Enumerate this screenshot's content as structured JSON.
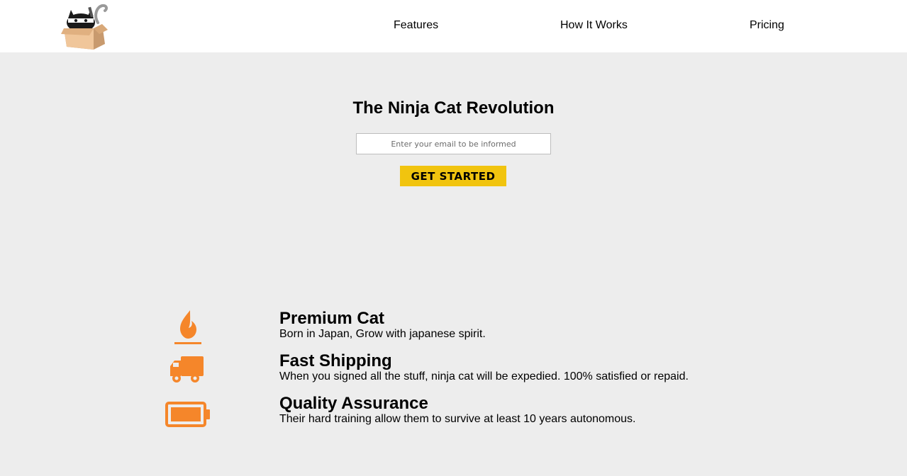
{
  "header": {
    "logo_icon": "ninja-cat-in-box-logo",
    "nav": [
      "Features",
      "How It Works",
      "Pricing"
    ]
  },
  "hero": {
    "title": "The Ninja Cat Revolution",
    "email_placeholder": "Enter your email to be informed",
    "button_label": "GET STARTED",
    "button_color": "#f1c40f"
  },
  "features": [
    {
      "icon": "fire-icon",
      "title": "Premium Cat",
      "description": "Born in Japan, Grow with japanese spirit."
    },
    {
      "icon": "truck-icon",
      "title": "Fast Shipping",
      "description": "When you signed all the stuff, ninja cat will be expedied. 100% satisfied or repaid."
    },
    {
      "icon": "battery-icon",
      "title": "Quality Assurance",
      "description": "Their hard training allow them to survive at least 10 years autonomous."
    }
  ],
  "colors": {
    "background": "#ededed",
    "header_background": "#ffffff",
    "icon_accent": "#f5862a"
  }
}
